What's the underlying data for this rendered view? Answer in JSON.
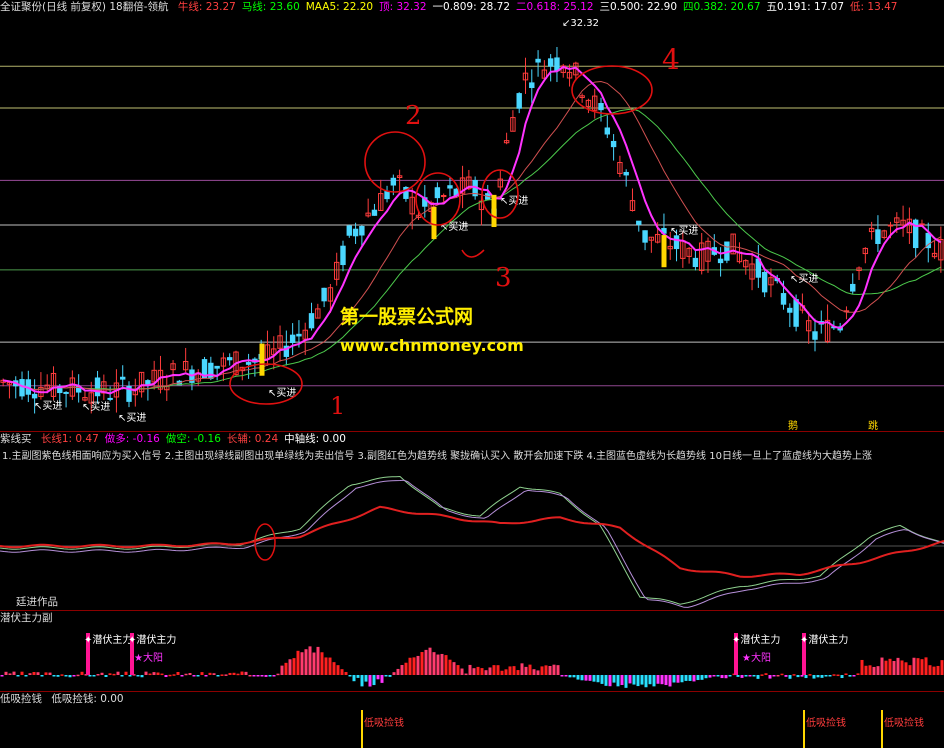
{
  "header": {
    "title": "全证聚份(日线 前复权) 18翻倍-领航",
    "items": [
      {
        "label": "牛线:",
        "value": "23.27",
        "color": "#ff4040"
      },
      {
        "label": "马线:",
        "value": "23.60",
        "color": "#00ff00"
      },
      {
        "label": "MAA5:",
        "value": "22.20",
        "color": "#ffff00"
      },
      {
        "label": "顶:",
        "value": "32.32",
        "color": "#ff00ff"
      },
      {
        "label": "一0.809:",
        "value": "28.72",
        "color": "#ffffff"
      },
      {
        "label": "二0.618:",
        "value": "25.12",
        "color": "#ff00ff"
      },
      {
        "label": "三0.500:",
        "value": "22.90",
        "color": "#ffffff"
      },
      {
        "label": "四0.382:",
        "value": "20.67",
        "color": "#00ff00"
      },
      {
        "label": "五0.191:",
        "value": "17.07",
        "color": "#ffffff"
      },
      {
        "label": "低:",
        "value": "13.47",
        "color": "#ff4040"
      }
    ]
  },
  "main_chart": {
    "peak_label": "32.32",
    "buy_label": "买进",
    "buy_marks": [
      {
        "text": "买进"
      },
      {
        "text": "买进"
      },
      {
        "text": "买进"
      },
      {
        "text": "买进"
      },
      {
        "text": "买进"
      },
      {
        "text": "买进"
      },
      {
        "text": "买进"
      },
      {
        "text": "买进"
      }
    ],
    "annotations": {
      "n1": "1",
      "n2": "2",
      "n3": "3",
      "n4": "4"
    },
    "watermark_title": "第一股票公式网",
    "watermark_url": "www.chnmoney.com",
    "bottom_marks": [
      "鹅",
      "跳"
    ]
  },
  "indicator1": {
    "name": "紫线买",
    "items": [
      {
        "label": "长线1:",
        "value": "0.47",
        "color": "#ff4040"
      },
      {
        "label": "做多:",
        "value": "-0.16",
        "color": "#ff00ff"
      },
      {
        "label": "做空:",
        "value": "-0.16",
        "color": "#00ff00"
      },
      {
        "label": "长辅:",
        "value": "0.24",
        "color": "#ff4040"
      },
      {
        "label": "中轴线:",
        "value": "0.00",
        "color": "#ffffff"
      }
    ],
    "description": "1.主副图紫色线相面响应为买入信号  2.主图出现绿线副图出现单绿线为卖出信号  3.副图红色为趋势线 聚拢确认买入 散开会加速下跌  4.主图蓝色虚线为长趋势线 10日线一旦上了蓝虚线为大趋势上涨",
    "author": "廷进作品"
  },
  "indicator2": {
    "name": "潜伏主力副",
    "signal_label": "潜伏主力",
    "sun_label": "大阳"
  },
  "indicator3": {
    "name": "低吸捡钱",
    "item_label": "低吸捡钱:",
    "item_value": "0.00",
    "signal_label": "低吸捡钱"
  }
}
